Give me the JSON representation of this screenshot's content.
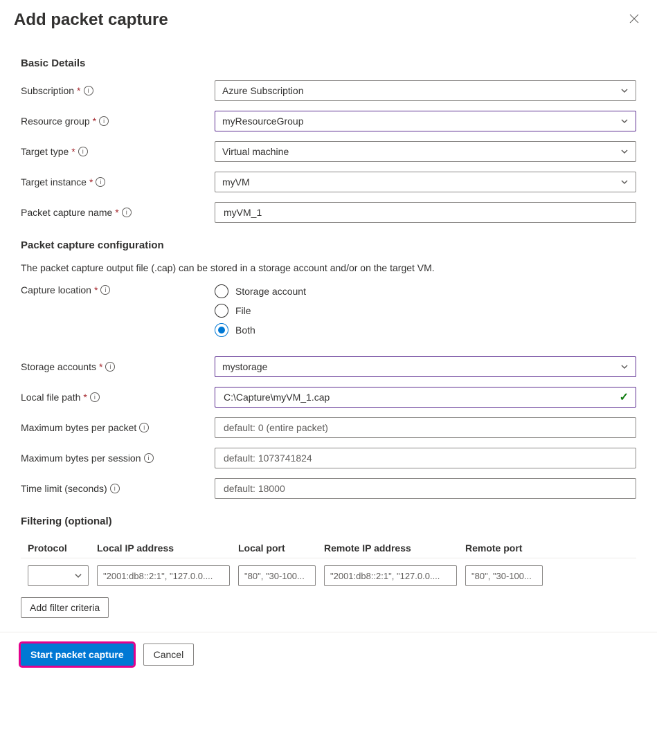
{
  "header": {
    "title": "Add packet capture"
  },
  "sections": {
    "basic": "Basic Details",
    "config": "Packet capture configuration",
    "filter": "Filtering (optional)"
  },
  "labels": {
    "subscription": "Subscription",
    "resourceGroup": "Resource group",
    "targetType": "Target type",
    "targetInstance": "Target instance",
    "pcapName": "Packet capture name",
    "captureLocation": "Capture location",
    "storageAccounts": "Storage accounts",
    "localFilePath": "Local file path",
    "maxBytesPacket": "Maximum bytes per packet",
    "maxBytesSession": "Maximum bytes per session",
    "timeLimit": "Time limit (seconds)"
  },
  "values": {
    "subscription": "Azure Subscription",
    "resourceGroup": "myResourceGroup",
    "targetType": "Virtual machine",
    "targetInstance": "myVM",
    "pcapName": "myVM_1",
    "storageAccounts": "mystorage",
    "localFilePath": "C:\\Capture\\myVM_1.cap"
  },
  "helperText": "The packet capture output file (.cap) can be stored in a storage account and/or on the target VM.",
  "captureLocation": {
    "options": [
      "Storage account",
      "File",
      "Both"
    ],
    "selected": "Both"
  },
  "placeholders": {
    "maxBytesPacket": "default: 0 (entire packet)",
    "maxBytesSession": "default: 1073741824",
    "timeLimit": "default: 18000",
    "localIP": "\"2001:db8::2:1\", \"127.0.0....",
    "remoteIP": "\"2001:db8::2:1\", \"127.0.0....",
    "localPort": "\"80\", \"30-100...",
    "remotePort": "\"80\", \"30-100..."
  },
  "filter": {
    "columns": {
      "protocol": "Protocol",
      "localIP": "Local IP address",
      "localPort": "Local port",
      "remoteIP": "Remote IP address",
      "remotePort": "Remote port"
    },
    "addButton": "Add filter criteria"
  },
  "footer": {
    "primary": "Start packet capture",
    "secondary": "Cancel"
  }
}
